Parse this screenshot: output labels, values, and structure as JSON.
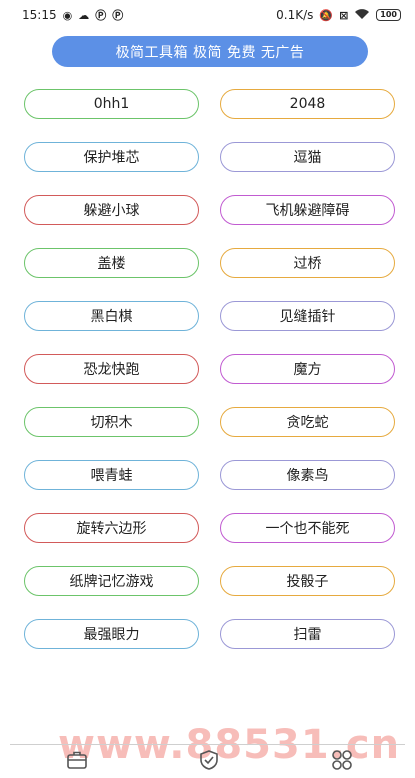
{
  "status_bar": {
    "time": "15:15",
    "left_icons": [
      "weibo-icon",
      "cloud-icon",
      "p-icon",
      "p-icon"
    ],
    "speed": "0.1K/s",
    "battery": "100"
  },
  "banner": {
    "text": "极简工具箱 极简 免费 无广告"
  },
  "games": [
    {
      "label": "0hh1",
      "color": "#6cc46a"
    },
    {
      "label": "2048",
      "color": "#e6aa3f"
    },
    {
      "label": "保护堆芯",
      "color": "#6fb3d9"
    },
    {
      "label": "逗猫",
      "color": "#9b98d6"
    },
    {
      "label": "躲避小球",
      "color": "#d25a5a"
    },
    {
      "label": "飞机躲避障碍",
      "color": "#c15bd1"
    },
    {
      "label": "盖楼",
      "color": "#6cc46a"
    },
    {
      "label": "过桥",
      "color": "#e6aa3f"
    },
    {
      "label": "黑白棋",
      "color": "#6fb3d9"
    },
    {
      "label": "见缝插针",
      "color": "#9b98d6"
    },
    {
      "label": "恐龙快跑",
      "color": "#d25a5a"
    },
    {
      "label": "魔方",
      "color": "#c15bd1"
    },
    {
      "label": "切积木",
      "color": "#6cc46a"
    },
    {
      "label": "贪吃蛇",
      "color": "#e6aa3f"
    },
    {
      "label": "喂青蛙",
      "color": "#6fb3d9"
    },
    {
      "label": "像素鸟",
      "color": "#9b98d6"
    },
    {
      "label": "旋转六边形",
      "color": "#d25a5a"
    },
    {
      "label": "一个也不能死",
      "color": "#c15bd1"
    },
    {
      "label": "纸牌记忆游戏",
      "color": "#6cc46a"
    },
    {
      "label": "投骰子",
      "color": "#e6aa3f"
    },
    {
      "label": "最强眼力",
      "color": "#6fb3d9"
    },
    {
      "label": "扫雷",
      "color": "#9b98d6"
    }
  ],
  "bottom_nav": [
    {
      "icon": "briefcase-icon"
    },
    {
      "icon": "shield-check-icon"
    },
    {
      "icon": "apps-grid-icon"
    }
  ],
  "watermark": "www.88531.cn"
}
